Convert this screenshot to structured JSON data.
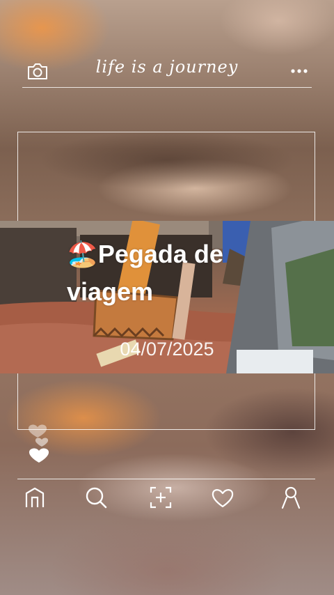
{
  "header": {
    "title": "life is a journey",
    "left_icon": "camera-icon",
    "right_icon": "more-dots-icon"
  },
  "post": {
    "title_emoji": "🏖️",
    "title_text": "Pegada de viagem",
    "date": "04/07/2025"
  },
  "bottom_nav": [
    {
      "icon": "home-icon"
    },
    {
      "icon": "search-icon"
    },
    {
      "icon": "scan-add-icon"
    },
    {
      "icon": "heart-icon"
    },
    {
      "icon": "profile-icon"
    }
  ],
  "colors": {
    "foreground": "#ffffff"
  }
}
